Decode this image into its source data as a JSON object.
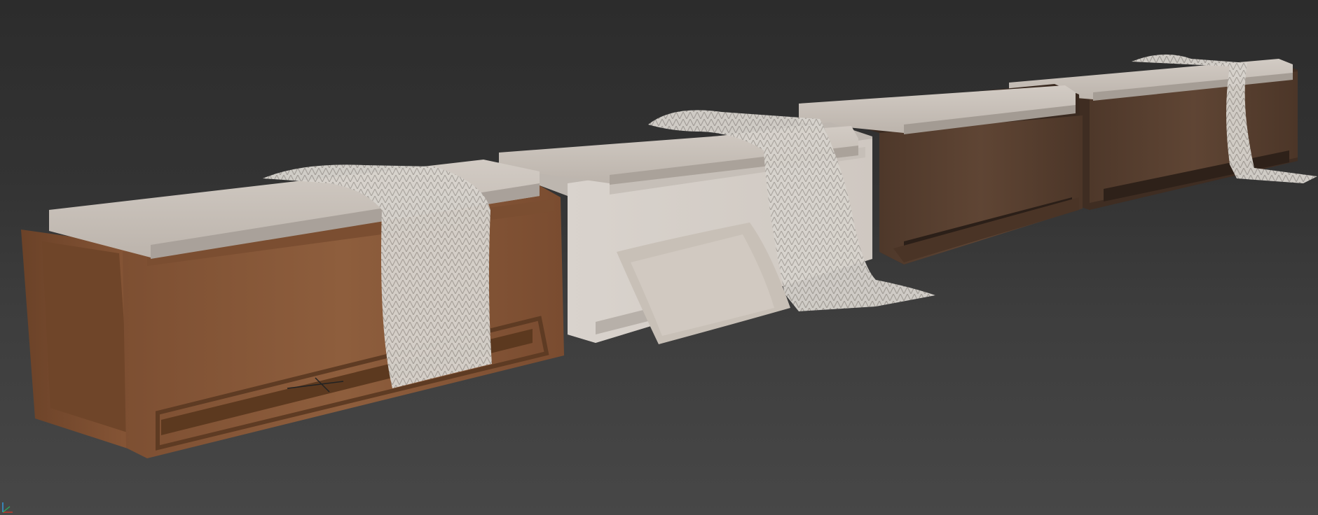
{
  "viewport": {
    "mode": "perspective",
    "shading": "default-shading"
  },
  "scene": {
    "objects": [
      {
        "type": "bench",
        "finish": "walnut-wood",
        "has_throw_blanket": true,
        "has_pillow": false
      },
      {
        "type": "bench",
        "finish": "whitewashed-wood",
        "has_throw_blanket": true,
        "has_pillow": true
      },
      {
        "type": "bench",
        "finish": "dark-oak-wood",
        "has_throw_blanket": false,
        "has_pillow": false
      },
      {
        "type": "bench",
        "finish": "dark-oak-wood",
        "has_throw_blanket": true,
        "has_pillow": false
      }
    ]
  },
  "colors": {
    "background_top": "#2c2c2c",
    "background_bottom": "#474747",
    "cushion": "#c9c2bb",
    "walnut": "#8a5a3a",
    "whitewash": "#d8d2cc",
    "dark_oak": "#5a4030",
    "blanket": "#d6d2cc"
  },
  "gizmo": {
    "icon": "axis-tripod-icon"
  }
}
